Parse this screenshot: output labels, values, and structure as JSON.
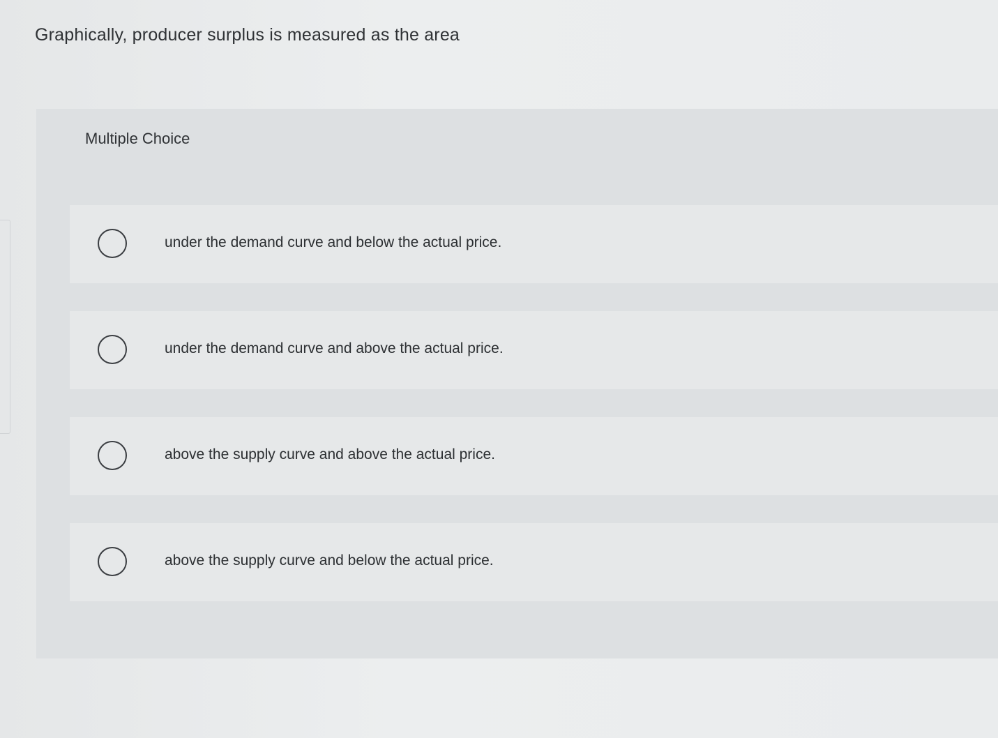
{
  "question": {
    "text": "Graphically, producer surplus is measured as the area"
  },
  "multiple_choice": {
    "header": "Multiple Choice",
    "options": [
      {
        "label": "under the demand curve and below the actual price.",
        "selected": false
      },
      {
        "label": "under the demand curve and above the actual price.",
        "selected": false
      },
      {
        "label": "above the supply curve and above the actual price.",
        "selected": false
      },
      {
        "label": "above the supply curve and below the actual price.",
        "selected": false
      }
    ]
  },
  "colors": {
    "page_bg": "#e9ebec",
    "panel_bg": "#dde0e2",
    "option_bg": "#e6e8e9",
    "text": "#2f3235",
    "radio_border": "#3b3e42"
  },
  "icons": {
    "radio": "radio-button-empty"
  }
}
